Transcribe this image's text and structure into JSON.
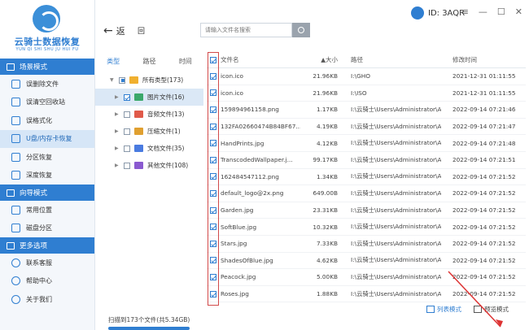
{
  "app": {
    "name": "云骑士数据恢复",
    "name_sub": "YUN QI SHI SHU JU HUI FU",
    "brand_color": "#2f7ed1"
  },
  "sidebar": {
    "sections": [
      {
        "title": "场景模式",
        "items": [
          {
            "label": "误删除文件",
            "icon": "file-delete-icon"
          },
          {
            "label": "误清空回收站",
            "icon": "recycle-bin-icon"
          },
          {
            "label": "误格式化",
            "icon": "format-icon"
          },
          {
            "label": "U盘/内存卡恢复",
            "icon": "usb-icon",
            "active": true
          },
          {
            "label": "分区恢复",
            "icon": "partition-icon"
          },
          {
            "label": "深度恢复",
            "icon": "deep-scan-icon"
          }
        ]
      },
      {
        "title": "向导模式",
        "items": [
          {
            "label": "常用位置",
            "icon": "location-icon"
          },
          {
            "label": "磁盘分区",
            "icon": "disk-icon"
          }
        ]
      },
      {
        "title": "更多选项",
        "items": [
          {
            "label": "联系客服",
            "icon": "support-icon"
          },
          {
            "label": "帮助中心",
            "icon": "help-icon"
          },
          {
            "label": "关于我们",
            "icon": "info-icon"
          }
        ]
      }
    ]
  },
  "topbar": {
    "back_label": "返",
    "home_label": "回",
    "search_placeholder": "请输入文件名搜索",
    "account_id": "ID: 3AQR"
  },
  "category_tabs": [
    "类型",
    "路径",
    "时间"
  ],
  "categories": [
    {
      "label": "所有类型(173)",
      "color": "#4a9be0"
    },
    {
      "label": "图片文件(16)",
      "color": "#3aa86b",
      "selected": true,
      "checked": true
    },
    {
      "label": "音频文件(13)",
      "color": "#e05a4a"
    },
    {
      "label": "压缩文件(1)",
      "color": "#e0a030"
    },
    {
      "label": "文档文件(35)",
      "color": "#4a7be0"
    },
    {
      "label": "其他文件(108)",
      "color": "#8a5ad0"
    }
  ],
  "table": {
    "columns": {
      "name": "文件名",
      "size": "大小",
      "path": "路径",
      "date": "修改时间"
    },
    "rows": [
      {
        "name": "icon.ico",
        "size": "21.96KB",
        "path": "I:\\GHO",
        "date": "2021-12-31 01:11:55"
      },
      {
        "name": "icon.ico",
        "size": "21.96KB",
        "path": "I:\\ISO",
        "date": "2021-12-31 01:11:55"
      },
      {
        "name": "159894961158.png",
        "size": "1.17KB",
        "path": "I:\\云骑士\\Users\\Administrator\\Ap...",
        "date": "2022-09-14 07:21:46"
      },
      {
        "name": "132FA02660474B84BF67...",
        "size": "4.19KB",
        "path": "I:\\云骑士\\Users\\Administrator\\Ap...",
        "date": "2022-09-14 07:21:47"
      },
      {
        "name": "HandPrints.jpg",
        "size": "4.12KB",
        "path": "I:\\云骑士\\Users\\Administrator\\Ap...",
        "date": "2022-09-14 07:21:48"
      },
      {
        "name": "TranscodedWallpaper.j...",
        "size": "99.17KB",
        "path": "I:\\云骑士\\Users\\Administrator\\Ap...",
        "date": "2022-09-14 07:21:51"
      },
      {
        "name": "162484547112.png",
        "size": "1.34KB",
        "path": "I:\\云骑士\\Users\\Administrator\\Ap...",
        "date": "2022-09-14 07:21:52"
      },
      {
        "name": "default_logo@2x.png",
        "size": "649.00B",
        "path": "I:\\云骑士\\Users\\Administrator\\Ap...",
        "date": "2022-09-14 07:21:52"
      },
      {
        "name": "Garden.jpg",
        "size": "23.31KB",
        "path": "I:\\云骑士\\Users\\Administrator\\Ap...",
        "date": "2022-09-14 07:21:52"
      },
      {
        "name": "SoftBlue.jpg",
        "size": "10.32KB",
        "path": "I:\\云骑士\\Users\\Administrator\\Ap...",
        "date": "2022-09-14 07:21:52"
      },
      {
        "name": "Stars.jpg",
        "size": "7.33KB",
        "path": "I:\\云骑士\\Users\\Administrator\\Ap...",
        "date": "2022-09-14 07:21:52"
      },
      {
        "name": "ShadesOfBlue.jpg",
        "size": "4.62KB",
        "path": "I:\\云骑士\\Users\\Administrator\\Ap...",
        "date": "2022-09-14 07:21:52"
      },
      {
        "name": "Peacock.jpg",
        "size": "5.00KB",
        "path": "I:\\云骑士\\Users\\Administrator\\Ap...",
        "date": "2022-09-14 07:21:52"
      },
      {
        "name": "Roses.jpg",
        "size": "1.88KB",
        "path": "I:\\云骑士\\Users\\Administrator\\Ap...",
        "date": "2022-09-14 07:21:52"
      }
    ]
  },
  "footer": {
    "scan_summary": "扫描到173个文件(共5.34GB)",
    "list_mode": "列表模式",
    "preview_mode": "预览模式"
  }
}
